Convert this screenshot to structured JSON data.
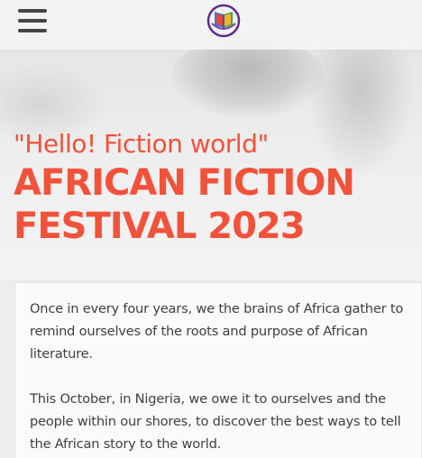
{
  "header": {
    "menu_icon": "hamburger-menu-icon",
    "logo_icon": "book-logo-icon"
  },
  "hero": {
    "tagline": "\"Hello! Fiction world\"",
    "headline_line1": "AFRICAN FICTION",
    "headline_line2": "FESTIVAL 2023"
  },
  "intro": {
    "paragraph1": "Once in every four years, we the brains of Africa gather to remind ourselves of the roots and purpose of African literature.",
    "paragraph2": "This October, in Nigeria, we owe it to ourselves and the people within our shores, to discover the best ways to tell the African story to the world."
  },
  "colors": {
    "accent": "#f2513a",
    "body_text": "#404040",
    "menu_icon": "#454545",
    "logo_purple": "#5b2d8e"
  }
}
